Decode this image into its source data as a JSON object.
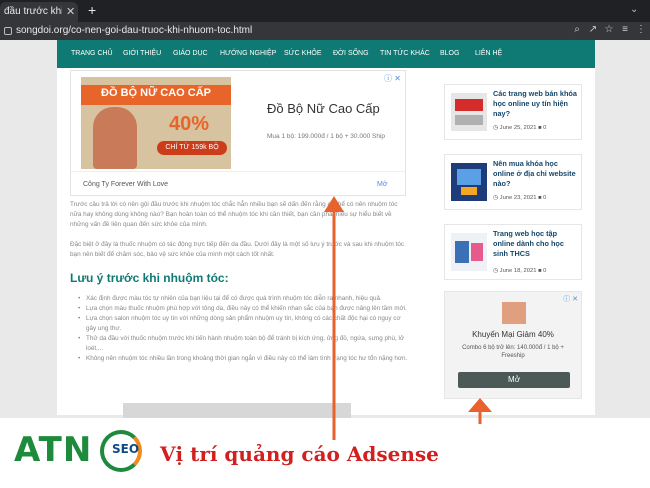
{
  "browser": {
    "tab_title": "đầu trước khi nhuộm",
    "tab_close": "✕",
    "new_tab": "+",
    "url": "songdoi.org/co-nen-goi-dau-truoc-khi-nhuom-toc.html"
  },
  "nav": {
    "items": [
      "TRANG CHỦ",
      "GIỚI THIỆU",
      "GIÁO DỤC",
      "HƯỚNG NGHIỆP",
      "SỨC KHỎE",
      "ĐỜI SỐNG",
      "TIN TỨC KHÁC",
      "BLOG",
      "LIÊN HỆ"
    ]
  },
  "ad_top": {
    "adchoice": "ⓘ ✕",
    "image_title": "ĐỒ BỘ NỮ CAO CẤP",
    "image_percent": "40%",
    "image_pill": "CHỈ TỪ 159k BỘ",
    "headline": "Đồ Bộ Nữ Cao Cấp",
    "price": "Mua 1 bộ: 199.000đ / 1 bộ + 30.000 Ship",
    "company": "Công Ty Forever With Love",
    "more": "Mở"
  },
  "article": {
    "para1": "Trước câu trả lời có nên gội đầu trước khi nhuộm tóc chắc hẳn nhiều bạn sẽ dấn đến rằng có thể có nên nhuộm tóc nữa hay không dùng không nào? Bạn hoàn toàn có thể nhuộm tóc khi cần thiết, bạn cần phải hiểu sự hiểu biết về những vấn đề liên quan đến sức khỏe của mình.",
    "para2": "Đặc biệt ở đây là thuốc nhuộm có tác động trực tiếp đến da đầu. Dưới đây là một số lưu ý trước và sau khi nhuộm tóc bạn nên biết để chăm sóc, bảo vệ sức khỏe của mình một cách tốt nhất.",
    "heading": "Lưu ý trước khi nhuộm tóc:",
    "bullets": [
      "Xác định được màu tóc tự nhiên của bạn liệu tại để có được quá trình nhuộm tóc diễn ra nhanh, hiệu quả.",
      "Lựa chọn màu thuốc nhuộm phù hợp với tông da, điều này có thể khiến nhan sắc của bạn được nâng lên tầm mới.",
      "Lựa chọn salon nhuộm tóc uy tín với những dòng sản phẩm nhuộm uy tín, không có các chất độc hại có nguy cơ gây ung thư.",
      "Thử da đầu với thuốc nhuộm trước khi tiến hành nhuộm toàn bộ để tránh bị kích ứng, ửng đỏ, ngứa, sưng phù, lở loét,...",
      "Không nên nhuộm tóc nhiều lần trong khoảng thời gian ngắn vì điều này có thể làm tình trạng tóc hư tổn nặng hơn."
    ]
  },
  "sidebar": {
    "posts": [
      {
        "title": "Các trang web bán khóa học online uy tín hiện nay?",
        "date": "June 25, 2021",
        "comments": "0"
      },
      {
        "title": "Nên mua khóa học online ở địa chỉ website nào?",
        "date": "June 23, 2021",
        "comments": "0"
      },
      {
        "title": "Trang web học tập online dành cho học sinh THCS",
        "date": "June 18, 2021",
        "comments": "0"
      }
    ],
    "ad": {
      "adchoice": "ⓘ ✕",
      "title": "Khuyến Mại Giảm 40%",
      "sub": "Combo 6 bộ trở lên: 140.000đ / 1 bộ + Freeship",
      "button": "Mở"
    }
  },
  "watermark": {
    "logo_text": "ATN",
    "logo_badge": "SEO",
    "caption": "Vị trí quảng cáo Adsense"
  },
  "colors": {
    "nav_bg": "#0f7a74",
    "accent_red": "#d02020",
    "arrow": "#e9612c",
    "logo_green": "#1e8a3c"
  }
}
